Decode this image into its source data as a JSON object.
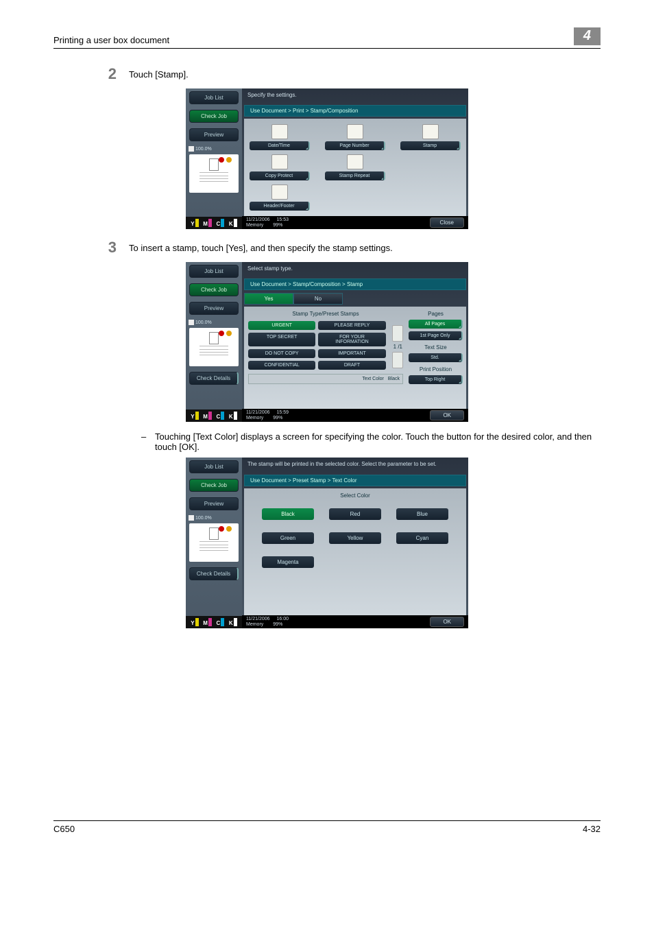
{
  "header": {
    "title": "Printing a user box document",
    "chapter": "4"
  },
  "steps": {
    "s2": {
      "num": "2",
      "text": "Touch [Stamp]."
    },
    "s3": {
      "num": "3",
      "text": "To insert a stamp, touch [Yes], and then specify the stamp settings."
    },
    "sub": "Touching [Text Color] displays a screen for specifying the color. Touch the button for the desired color, and then touch [OK]."
  },
  "p1": {
    "sidebar": {
      "joblist": "Job List",
      "checkjob": "Check Job",
      "preview": "Preview",
      "zoom": "100.0%"
    },
    "instr": "Specify the settings.",
    "bc": "Use Document > Print > Stamp/Composition",
    "opts": [
      "Date/Time",
      "Page Number",
      "Stamp",
      "Copy Protect",
      "Stamp Repeat",
      "Header/Footer"
    ],
    "foot": {
      "date": "11/21/2006",
      "time": "15:53",
      "mem": "Memory",
      "memv": "99%",
      "close": "Close"
    }
  },
  "p2": {
    "sidebar": {
      "joblist": "Job List",
      "checkjob": "Check Job",
      "preview": "Preview",
      "zoom": "100.0%",
      "checkdet": "Check Details"
    },
    "instr": "Select stamp type.",
    "bc": "Use Document > Stamp/Composition > Stamp",
    "yes": "Yes",
    "no": "No",
    "sthead": "Stamp Type/Preset Stamps",
    "presets": [
      "URGENT",
      "PLEASE REPLY",
      "TOP SECRET",
      "FOR YOUR\nINFORMATION",
      "DO NOT COPY",
      "IMPORTANT",
      "CONFIDENTIAL",
      "DRAFT"
    ],
    "page": "1  /1",
    "pages_h": "Pages",
    "allpages": "All Pages",
    "firstpage": "1st Page Only",
    "tsize_h": "Text Size",
    "tsize": "Std.",
    "ppos_h": "Print Position",
    "ppos": "Top Right",
    "tclab": "Text Color",
    "tcval": "Black",
    "foot": {
      "date": "11/21/2006",
      "time": "15:59",
      "mem": "Memory",
      "memv": "99%",
      "ok": "OK"
    }
  },
  "p3": {
    "sidebar": {
      "joblist": "Job List",
      "checkjob": "Check Job",
      "preview": "Preview",
      "zoom": "100.0%",
      "checkdet": "Check Details"
    },
    "instr": "The stamp will be printed in the selected color. Select the parameter to be set.",
    "bc": "Use Document > Preset Stamp > Text Color",
    "colhead": "Select Color",
    "colors": [
      "Black",
      "Red",
      "Blue",
      "Green",
      "Yellow",
      "Cyan",
      "Magenta"
    ],
    "foot": {
      "date": "11/21/2006",
      "time": "16:00",
      "mem": "Memory",
      "memv": "99%",
      "ok": "OK"
    }
  },
  "footer": {
    "left": "C650",
    "right": "4-32"
  }
}
